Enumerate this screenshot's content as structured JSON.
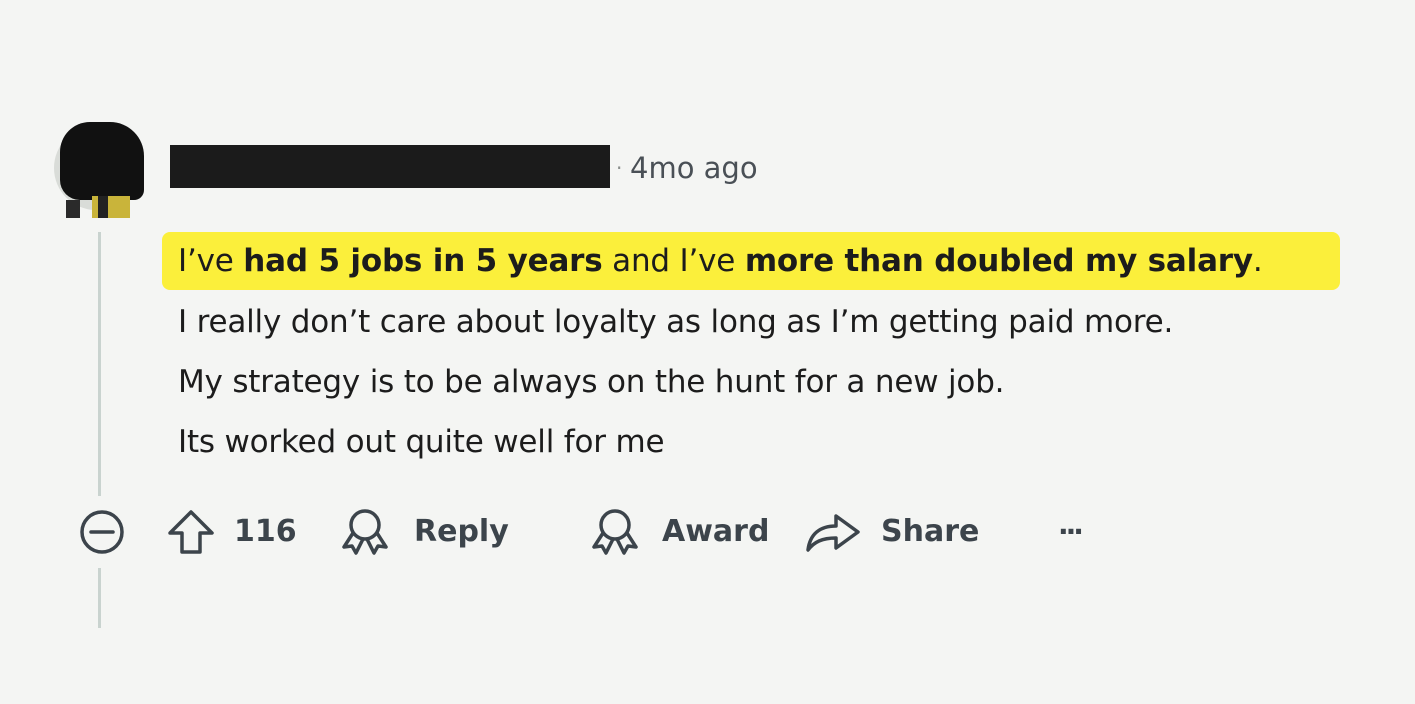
{
  "comment": {
    "timestamp": "4mo ago",
    "separator": "·",
    "lines": [
      {
        "highlighted": true,
        "segments": [
          {
            "text": "I’ve ",
            "bold": false
          },
          {
            "text": "had 5 jobs in 5 years",
            "bold": true
          },
          {
            "text": " and I’ve ",
            "bold": false
          },
          {
            "text": "more than doubled my salary",
            "bold": true
          },
          {
            "text": ".",
            "bold": false
          }
        ]
      },
      {
        "highlighted": false,
        "segments": [
          {
            "text": "I really don’t care about loyalty as long as I’m getting paid more.",
            "bold": false
          }
        ]
      },
      {
        "highlighted": false,
        "segments": [
          {
            "text": "My strategy is to be always on the hunt for a new job.",
            "bold": false
          }
        ]
      },
      {
        "highlighted": false,
        "segments": [
          {
            "text": "Its worked out quite well for me",
            "bold": false
          }
        ]
      }
    ]
  },
  "actions": {
    "upvote_count": "116",
    "reply_label": "Reply",
    "award_label": "Award",
    "share_label": "Share",
    "more_label": "···"
  },
  "colors": {
    "highlight": "#fbef3b",
    "action_text": "#3c444b",
    "thread_line": "#c9d3cf",
    "background": "#f4f5f3"
  },
  "icons": {
    "collapse": "minus-circle-icon",
    "upvote": "arrow-up-icon",
    "reply": "comment-ribbon-icon",
    "award": "award-icon",
    "share": "share-arrow-icon",
    "more": "ellipsis-icon"
  }
}
